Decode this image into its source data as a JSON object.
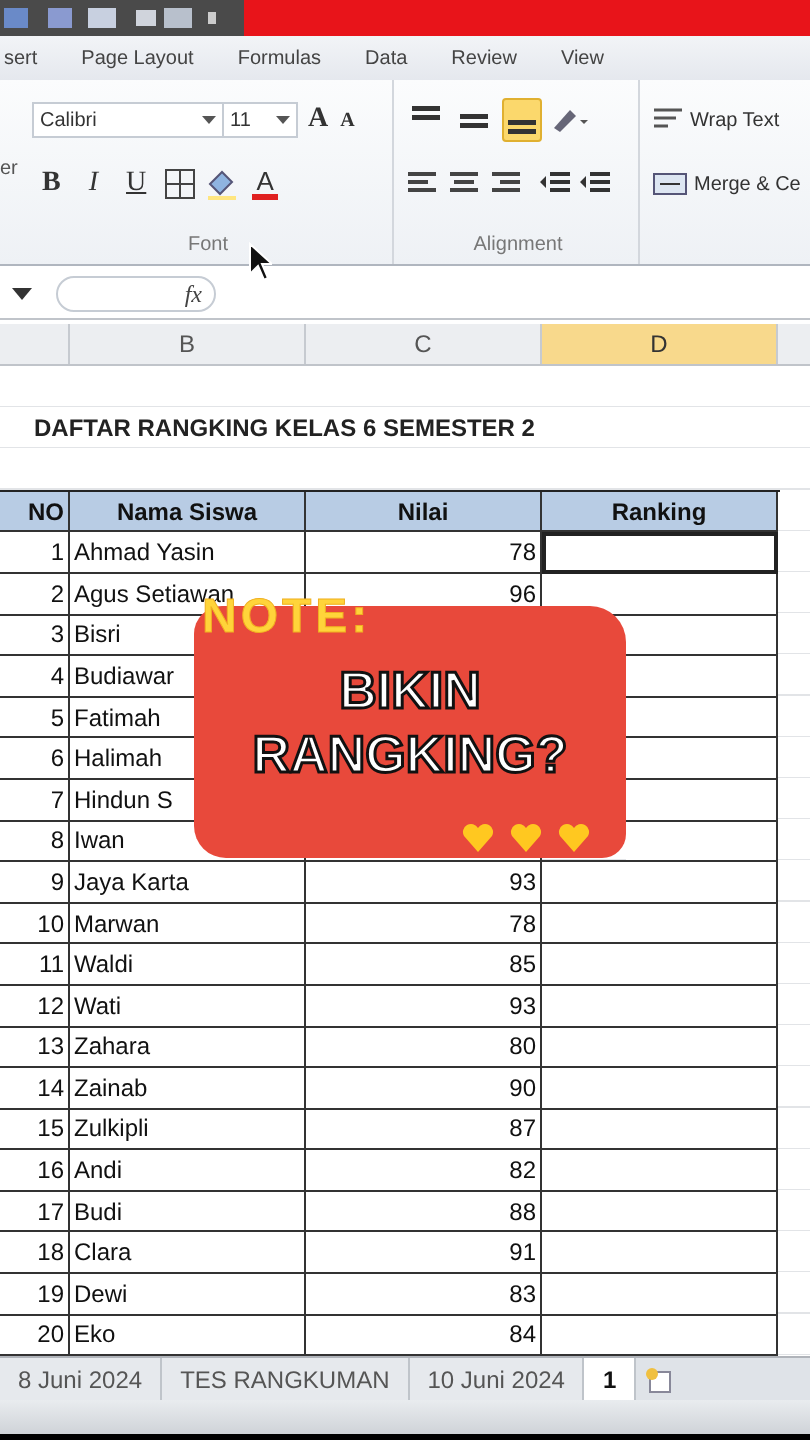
{
  "ribbon_tabs": [
    "sert",
    "Page Layout",
    "Formulas",
    "Data",
    "Review",
    "View"
  ],
  "ribbon": {
    "cut_label": "er",
    "font": {
      "name": "Calibri",
      "size": "11",
      "grow": "A",
      "shrink": "A",
      "style_buttons": [
        "B",
        "I",
        "U"
      ],
      "font_color": "A",
      "group_label": "Font"
    },
    "alignment": {
      "vertical": [
        {
          "kind": "top",
          "selected": false
        },
        {
          "kind": "middle",
          "selected": false
        },
        {
          "kind": "bottom",
          "selected": true
        }
      ],
      "wrap_text": "Wrap Text",
      "merge": "Merge & Ce",
      "group_label": "Alignment"
    }
  },
  "formula_bar": {
    "fx": "fx"
  },
  "column_headers": [
    {
      "label": "B",
      "selected": false
    },
    {
      "label": "C",
      "selected": false
    },
    {
      "label": "D",
      "selected": true
    }
  ],
  "sheet_title": "DAFTAR RANGKING KELAS 6 SEMESTER 2",
  "table": {
    "columns": [
      "NO",
      "Nama Siswa",
      "Nilai",
      "Ranking"
    ],
    "rows": [
      {
        "no": "1",
        "name": "Ahmad Yasin",
        "nilai": "78",
        "selected": true
      },
      {
        "no": "2",
        "name": "Agus Setiawan",
        "nilai": "96",
        "selected": false
      },
      {
        "no": "3",
        "name": "Bisri",
        "selected": false
      },
      {
        "no": "4",
        "name": "Budiawar",
        "selected": false
      },
      {
        "no": "5",
        "name": "Fatimah",
        "selected": false
      },
      {
        "no": "6",
        "name": "Halimah",
        "selected": false
      },
      {
        "no": "7",
        "name": "Hindun S",
        "selected": false
      },
      {
        "no": "8",
        "name": "Iwan",
        "selected": false
      },
      {
        "no": "9",
        "name": "Jaya Karta",
        "nilai": "93",
        "selected": false
      },
      {
        "no": "10",
        "name": "Marwan",
        "nilai": "78",
        "selected": false
      },
      {
        "no": "11",
        "name": "Waldi",
        "nilai": "85",
        "selected": false
      },
      {
        "no": "12",
        "name": "Wati",
        "nilai": "93",
        "selected": false
      },
      {
        "no": "13",
        "name": "Zahara",
        "nilai": "80",
        "selected": false
      },
      {
        "no": "14",
        "name": "Zainab",
        "nilai": "90",
        "selected": false
      },
      {
        "no": "15",
        "name": "Zulkipli",
        "nilai": "87",
        "selected": false
      },
      {
        "no": "16",
        "name": "Andi",
        "nilai": "82",
        "selected": false
      },
      {
        "no": "17",
        "name": "Budi",
        "nilai": "88",
        "selected": false
      },
      {
        "no": "18",
        "name": "Clara",
        "nilai": "91",
        "selected": false
      },
      {
        "no": "19",
        "name": "Dewi",
        "nilai": "83",
        "selected": false
      },
      {
        "no": "20",
        "name": "Eko",
        "nilai": "84",
        "selected": false
      }
    ]
  },
  "sheet_tabs": [
    {
      "label": "8 Juni 2024",
      "selected": false
    },
    {
      "label": "TES RANGKUMAN",
      "selected": false
    },
    {
      "label": "10 Juni 2024",
      "selected": false
    },
    {
      "label": "1",
      "selected": true
    }
  ],
  "overlay": {
    "tag": "NOTE:",
    "text": "BIKIN RANGKING?"
  }
}
